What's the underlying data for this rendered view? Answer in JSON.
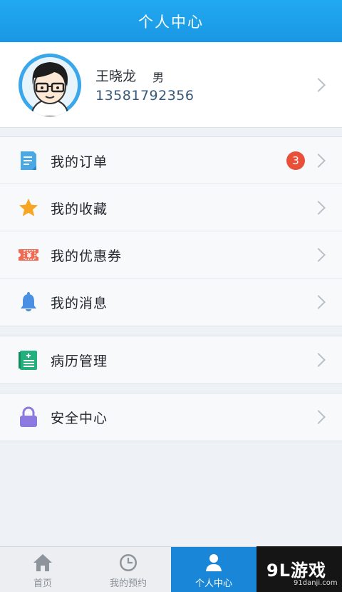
{
  "header": {
    "title": "个人中心"
  },
  "profile": {
    "name": "王晓龙",
    "gender": "男",
    "phone": "13581792356"
  },
  "menu_groups": [
    [
      {
        "label": "我的订单",
        "icon": "order-icon",
        "badge": "3"
      },
      {
        "label": "我的收藏",
        "icon": "star-icon"
      },
      {
        "label": "我的优惠券",
        "icon": "coupon-icon"
      },
      {
        "label": "我的消息",
        "icon": "bell-icon"
      }
    ],
    [
      {
        "label": "病历管理",
        "icon": "medical-record-icon"
      }
    ],
    [
      {
        "label": "安全中心",
        "icon": "lock-icon"
      }
    ]
  ],
  "tabbar": {
    "tabs": [
      {
        "label": "首页",
        "icon": "home-icon"
      },
      {
        "label": "我的预约",
        "icon": "clock-icon"
      },
      {
        "label": "个人中心",
        "icon": "person-icon",
        "active": true
      }
    ]
  },
  "watermark": {
    "brand": "9L游戏",
    "site": "91danji.com"
  },
  "colors": {
    "header": "#1a97e4",
    "badge": "#e9503a",
    "active_tab": "#1a86d8"
  }
}
